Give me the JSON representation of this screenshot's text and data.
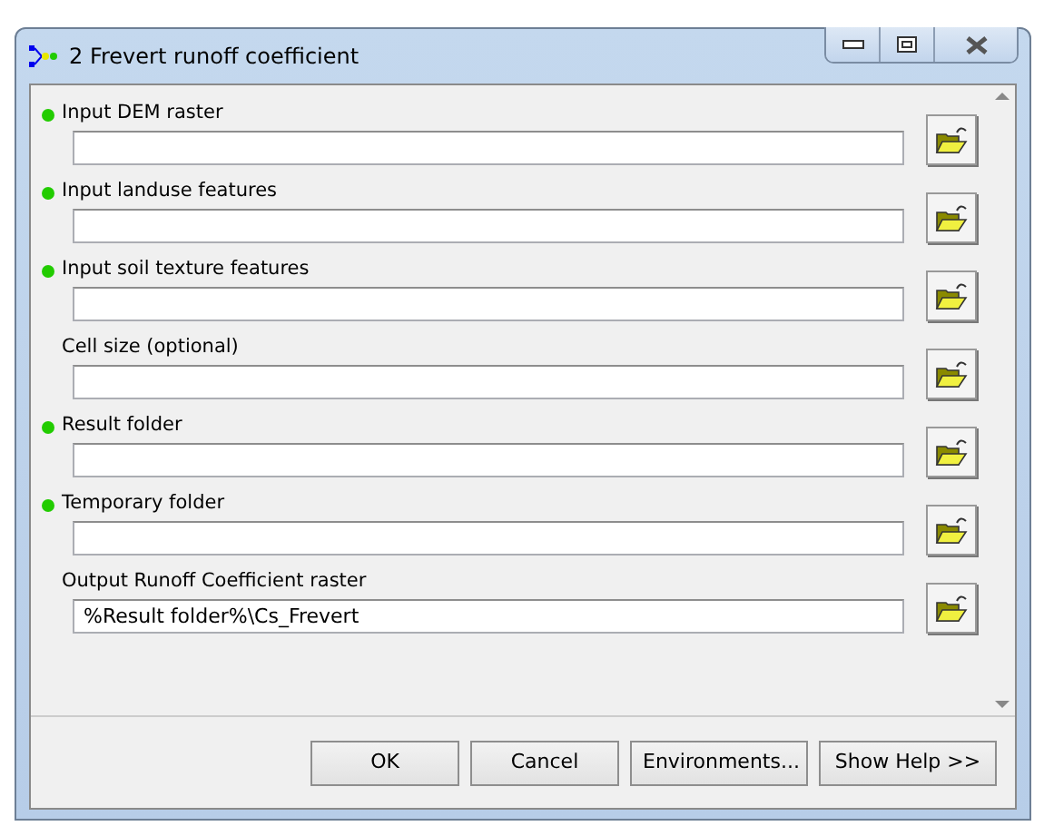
{
  "window": {
    "title": "2 Frevert runoff coefficient"
  },
  "parameters": [
    {
      "label": "Input DEM raster",
      "required": true
    },
    {
      "label": "Input landuse features",
      "required": true
    },
    {
      "label": "Input soil texture features",
      "required": true
    },
    {
      "label": "Cell size (optional)",
      "required": false
    },
    {
      "label": "Result folder",
      "required": true
    },
    {
      "label": "Temporary folder",
      "required": true
    },
    {
      "label": "Output Runoff Coefficient raster",
      "required": false,
      "value": "%Result folder%\\Cs_Frevert"
    }
  ],
  "buttons": [
    "OK",
    "Cancel",
    "Environments...",
    "Show Help >>"
  ]
}
